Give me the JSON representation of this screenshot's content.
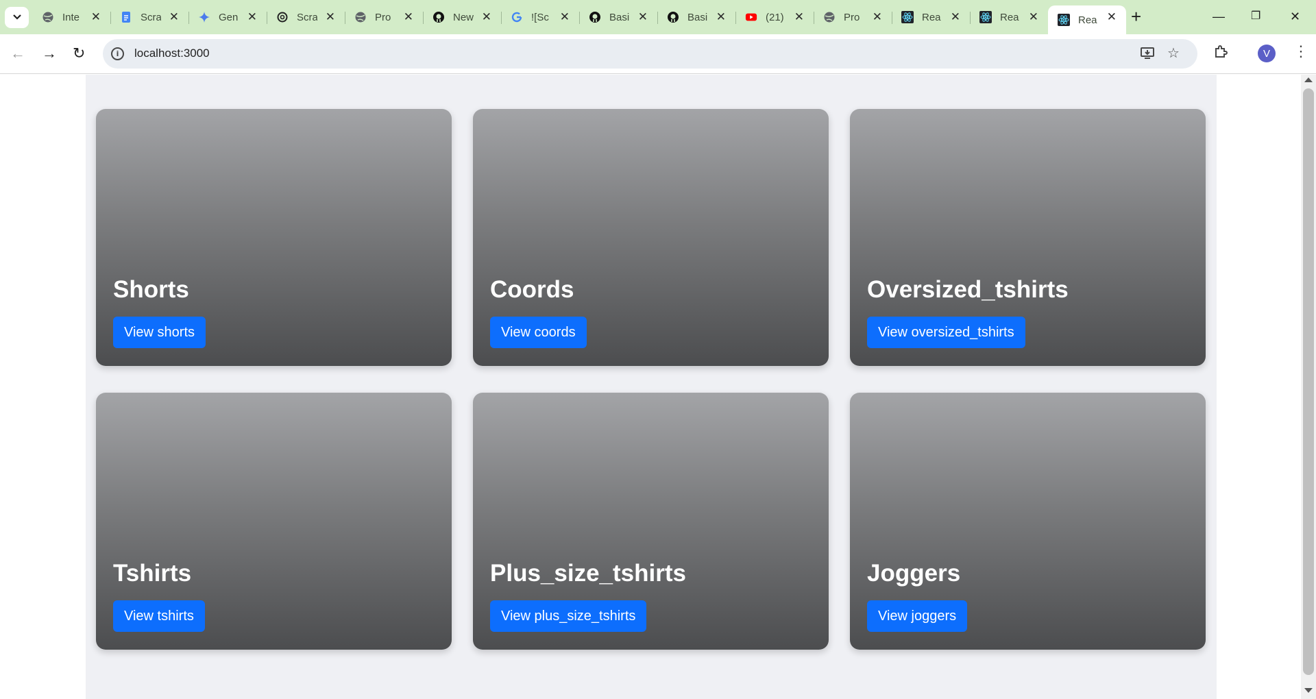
{
  "tabs": [
    {
      "title": "Inte",
      "icon": "globe-icon",
      "color": "#5f6368"
    },
    {
      "title": "Scra",
      "icon": "docs-icon",
      "color": "#4285f4"
    },
    {
      "title": "Gen",
      "icon": "gemini-icon",
      "color": "#4b7bec"
    },
    {
      "title": "Scra",
      "icon": "openai-icon",
      "color": "#222222"
    },
    {
      "title": "Pro",
      "icon": "globe-icon",
      "color": "#5f6368"
    },
    {
      "title": "New",
      "icon": "github-icon",
      "color": "#111111"
    },
    {
      "title": "![Sc",
      "icon": "google-icon",
      "color": "#4285f4"
    },
    {
      "title": "Basi",
      "icon": "github-icon",
      "color": "#111111"
    },
    {
      "title": "Basi",
      "icon": "github-icon",
      "color": "#111111"
    },
    {
      "title": "(21)",
      "icon": "youtube-icon",
      "color": "#ff0000"
    },
    {
      "title": "Pro",
      "icon": "globe-icon",
      "color": "#5f6368"
    },
    {
      "title": "Rea",
      "icon": "react-icon",
      "color": "#61dafb"
    },
    {
      "title": "Rea",
      "icon": "react-icon",
      "color": "#61dafb"
    },
    {
      "title": "Rea",
      "icon": "react-icon",
      "color": "#61dafb",
      "active": true
    }
  ],
  "address_bar": {
    "url": "localhost:3000"
  },
  "profile": {
    "initial": "V",
    "color": "#5b5fc7"
  },
  "accent_color": "#0d6efd",
  "categories": [
    {
      "title": "Shorts",
      "button": "View shorts"
    },
    {
      "title": "Coords",
      "button": "View coords"
    },
    {
      "title": "Oversized_tshirts",
      "button": "View oversized_tshirts"
    },
    {
      "title": "Tshirts",
      "button": "View tshirts"
    },
    {
      "title": "Plus_size_tshirts",
      "button": "View plus_size_tshirts"
    },
    {
      "title": "Joggers",
      "button": "View joggers"
    }
  ]
}
